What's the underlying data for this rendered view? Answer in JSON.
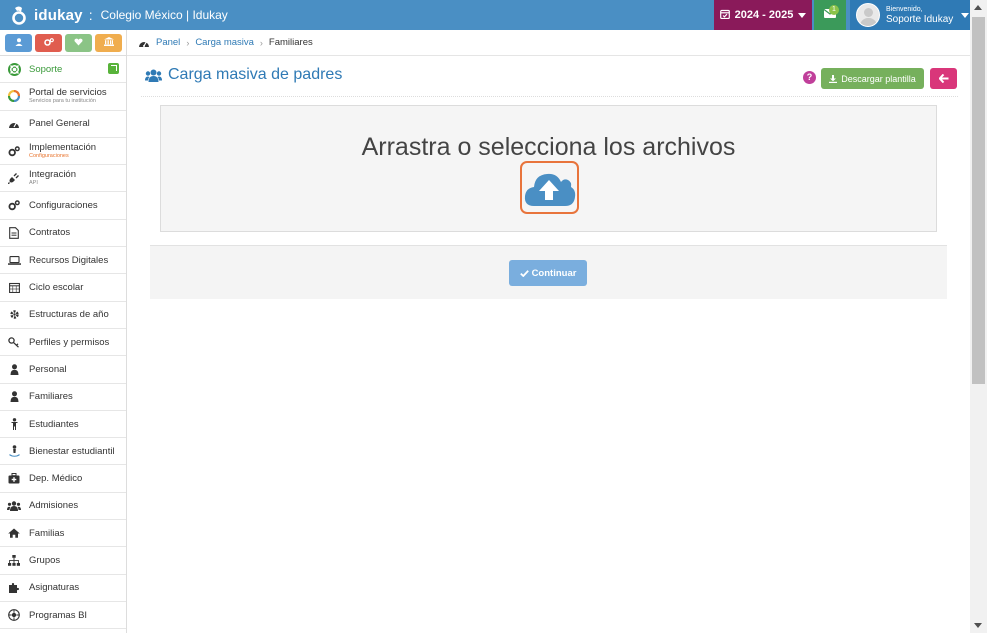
{
  "app": {
    "logo_text": "idukay",
    "logo_separator": ":",
    "school_name": "Colegio México | Idukay"
  },
  "topbar": {
    "school_year": "2024 - 2025",
    "messages_count": "1",
    "welcome": "Bienvenido,",
    "user_name": "Soporte Idukay"
  },
  "sidebar": {
    "quick_buttons": [
      {
        "icon": "user-icon",
        "color": "#5b9bd5"
      },
      {
        "icon": "cogs-icon",
        "color": "#e05d4f"
      },
      {
        "icon": "heart-icon",
        "color": "#8bc486"
      },
      {
        "icon": "institution-icon",
        "color": "#f0ad4e"
      }
    ],
    "support_label": "Soporte",
    "items": [
      {
        "label": "Portal de servicios",
        "sub": "Servicios para tu institución",
        "icon": "portal-icon"
      },
      {
        "label": "Panel General",
        "sub": "",
        "icon": "dashboard-icon"
      },
      {
        "label": "Implementación",
        "sub": "Configuraciones",
        "icon": "cogs-icon"
      },
      {
        "label": "Integración",
        "sub": "API",
        "icon": "plug-icon"
      },
      {
        "label": "Configuraciones",
        "sub": "",
        "icon": "cogs-icon"
      },
      {
        "label": "Contratos",
        "sub": "",
        "icon": "file-icon"
      },
      {
        "label": "Recursos Digitales",
        "sub": "",
        "icon": "laptop-icon"
      },
      {
        "label": "Ciclo escolar",
        "sub": "",
        "icon": "calendar-icon"
      },
      {
        "label": "Estructuras de año",
        "sub": "",
        "icon": "gear-icon"
      },
      {
        "label": "Perfiles y permisos",
        "sub": "",
        "icon": "key-icon"
      },
      {
        "label": "Personal",
        "sub": "",
        "icon": "user-icon"
      },
      {
        "label": "Familiares",
        "sub": "",
        "icon": "user-icon"
      },
      {
        "label": "Estudiantes",
        "sub": "",
        "icon": "child-icon"
      },
      {
        "label": "Bienestar estudiantil",
        "sub": "",
        "icon": "wellbeing-icon"
      },
      {
        "label": "Dep. Médico",
        "sub": "",
        "icon": "medkit-icon"
      },
      {
        "label": "Admisiones",
        "sub": "",
        "icon": "users-icon"
      },
      {
        "label": "Familias",
        "sub": "",
        "icon": "home-icon"
      },
      {
        "label": "Grupos",
        "sub": "",
        "icon": "sitemap-icon"
      },
      {
        "label": "Asignaturas",
        "sub": "",
        "icon": "puzzle-icon"
      },
      {
        "label": "Programas BI",
        "sub": "",
        "icon": "bi-icon"
      }
    ]
  },
  "breadcrumb": {
    "items": [
      "Panel",
      "Carga masiva",
      "Familiares"
    ]
  },
  "page": {
    "title": "Carga masiva de padres",
    "help_label": "?",
    "download_label": "Descargar plantilla",
    "back_icon": "arrow-left-icon"
  },
  "dropzone": {
    "title": "Arrastra o selecciona los archivos",
    "icon": "cloud-upload-icon"
  },
  "actions": {
    "continue_label": "Continuar"
  },
  "colors": {
    "topbar": "#4a8fc4",
    "year_badge": "#8a1a5a",
    "messages": "#3b9a5a",
    "download_button": "#76b05c",
    "back_button": "#d9367a",
    "upload_highlight": "#e8743c",
    "continue_button": "#7aaede"
  }
}
